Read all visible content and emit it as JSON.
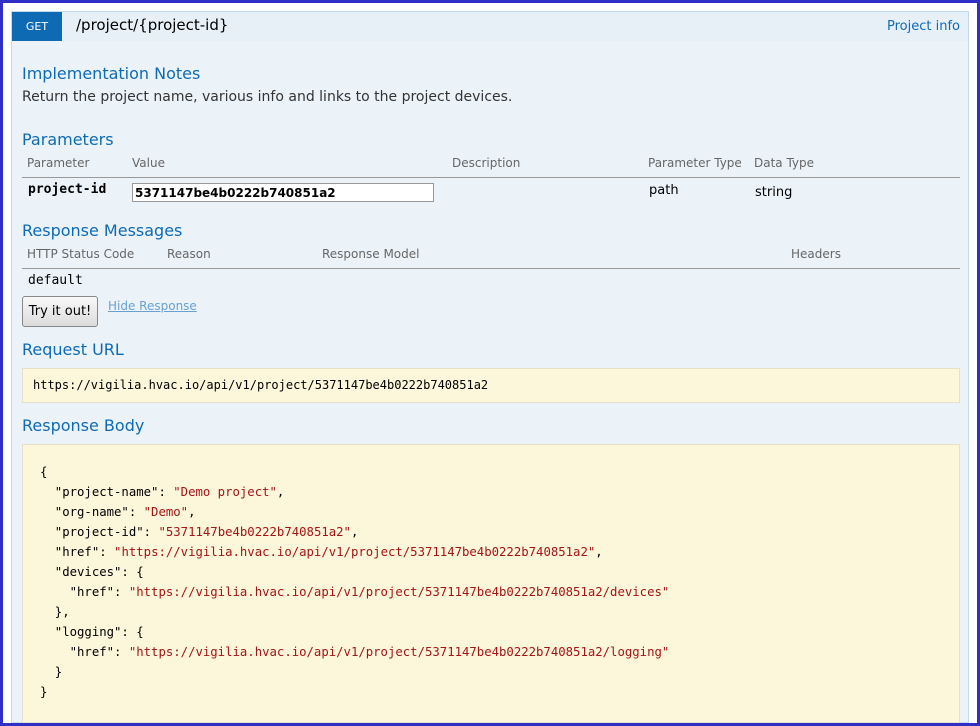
{
  "operation": {
    "method": "GET",
    "path": "/project/{project-id}",
    "summary_link": "Project info"
  },
  "implementation_notes": {
    "title": "Implementation Notes",
    "text": "Return the project name, various info and links to the project devices."
  },
  "parameters": {
    "title": "Parameters",
    "columns": [
      "Parameter",
      "Value",
      "Description",
      "Parameter Type",
      "Data Type"
    ],
    "rows": [
      {
        "name": "project-id",
        "value": "5371147be4b0222b740851a2",
        "description": "",
        "param_type": "path",
        "data_type": "string"
      }
    ]
  },
  "response_messages": {
    "title": "Response Messages",
    "columns": [
      "HTTP Status Code",
      "Reason",
      "Response Model",
      "Headers"
    ],
    "rows": [
      {
        "code": "default"
      }
    ]
  },
  "actions": {
    "try_label": "Try it out!",
    "hide_label": "Hide Response"
  },
  "request_url": {
    "title": "Request URL",
    "value": "https://vigilia.hvac.io/api/v1/project/5371147be4b0222b740851a2"
  },
  "response_body": {
    "title": "Response Body",
    "lines": [
      [
        {
          "t": "{"
        }
      ],
      [
        {
          "t": "  \"project-name\": "
        },
        {
          "t": "\"Demo project\"",
          "s": 1
        },
        {
          "t": ","
        }
      ],
      [
        {
          "t": "  \"org-name\": "
        },
        {
          "t": "\"Demo\"",
          "s": 1
        },
        {
          "t": ","
        }
      ],
      [
        {
          "t": "  \"project-id\": "
        },
        {
          "t": "\"5371147be4b0222b740851a2\"",
          "s": 1
        },
        {
          "t": ","
        }
      ],
      [
        {
          "t": "  \"href\": "
        },
        {
          "t": "\"https://vigilia.hvac.io/api/v1/project/5371147be4b0222b740851a2\"",
          "s": 1
        },
        {
          "t": ","
        }
      ],
      [
        {
          "t": "  \"devices\": {"
        }
      ],
      [
        {
          "t": "    \"href\": "
        },
        {
          "t": "\"https://vigilia.hvac.io/api/v1/project/5371147be4b0222b740851a2/devices\"",
          "s": 1
        }
      ],
      [
        {
          "t": "  },"
        }
      ],
      [
        {
          "t": "  \"logging\": {"
        }
      ],
      [
        {
          "t": "    \"href\": "
        },
        {
          "t": "\"https://vigilia.hvac.io/api/v1/project/5371147be4b0222b740851a2/logging\"",
          "s": 1
        }
      ],
      [
        {
          "t": "  }"
        }
      ],
      [
        {
          "t": "}"
        }
      ]
    ]
  },
  "colors": {
    "accent": "#0f6ab4",
    "panel_bg": "#ebf3f9",
    "code_bg": "#fcf6db",
    "string": "#a31515"
  }
}
